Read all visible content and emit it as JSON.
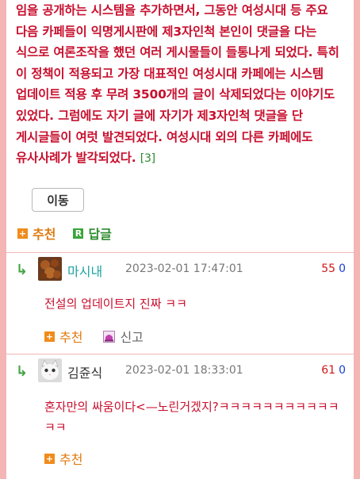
{
  "article": {
    "paragraph": "임을 공개하는 시스템을 추가하면서, 그동안 여성시대 등 주요 다음 카페들이 익명게시판에 제3자인척 본인이 댓글을 다는 식으로 여론조작을 했던 여러 게시물들이 들통나게 되었다. 특히 이 정책이 적용되고 가장 대표적인 여성시대 카페에는 시스템 업데이트 적용 후 무려 3500개의 글이 삭제되었다는 이야기도 있었다. 그럼에도 자기 글에 자기가 제3자인척 댓글을 단 게시글들이 여럿 발견되었다. 여성시대 외의 다른 카페에도 유사사례가 발각되었다.",
    "ref": "[3]",
    "move_button": "이동"
  },
  "actions": {
    "recommend": "추천",
    "reply": "답글",
    "reply_badge": "R"
  },
  "comments": [
    {
      "nickname": "마시내",
      "nickname_color": "#1fa3a3",
      "date": "2023-02-01 17:47:01",
      "up": "55",
      "down": "0",
      "body": "전설의 업데이트지 진짜 ㅋㅋ",
      "recommend": "추천",
      "report": "신고"
    },
    {
      "nickname": "김쥰식",
      "nickname_color": "#333333",
      "date": "2023-02-01 18:33:01",
      "up": "61",
      "down": "0",
      "body": "혼자만의 싸움이다<—노린거겠지?ㅋㅋㅋㅋㅋㅋㅋㅋㅋㅋㅋㅋㅋ",
      "recommend": "추천"
    }
  ],
  "colors": {
    "accent_red": "#c8102e",
    "orange": "#e07a10",
    "green": "#2e8b2e",
    "blue": "#1a3fd1"
  }
}
